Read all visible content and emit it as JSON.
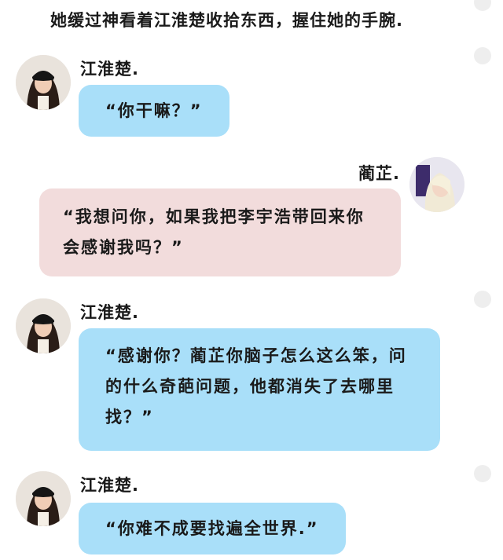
{
  "narration": "她缓过神看着江淮楚收拾东西，握住她的手腕.",
  "messages": [
    {
      "speaker": "江淮楚.",
      "text": "“你干嘛？”"
    },
    {
      "speaker": "蔺芷.",
      "text": "“我想问你，如果我把李宇浩带回来你\n会感谢我吗？”"
    },
    {
      "speaker": "江淮楚.",
      "text": "“感谢你？蔺芷你脑子怎么这么笨，问\n的什么奇葩问题，他都消失了去哪里\n找？”"
    },
    {
      "speaker": "江淮楚.",
      "text": "“你难不成要找遍全世界.”"
    }
  ],
  "colors": {
    "left_bubble": "#a9dff9",
    "right_bubble": "#f2dcdc",
    "menu_dot": "#eeeeee"
  }
}
